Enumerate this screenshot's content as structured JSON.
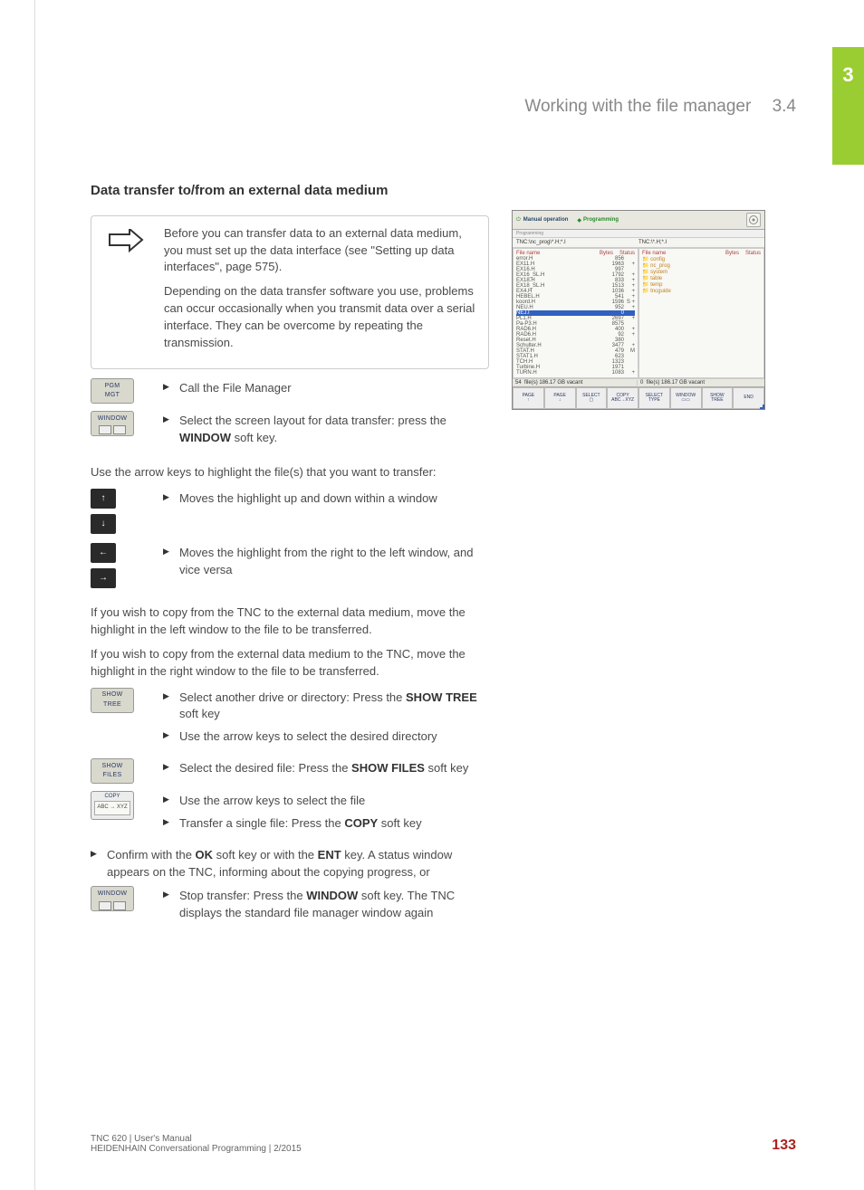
{
  "header": {
    "title": "Working with the file manager",
    "section": "3.4"
  },
  "chapter_tab": "3",
  "h2": "Data transfer to/from an external data medium",
  "note": {
    "p1": "Before you can transfer data to an external data medium, you must set up the data interface (see \"Setting up data interfaces\", page 575).",
    "p2": "Depending on the data transfer software you use, problems can occur occasionally when you transmit data over a serial interface. They can be overcome by repeating the transmission."
  },
  "keys": {
    "pgm_mgt": "PGM\nMGT",
    "window": "WINDOW",
    "show_tree": "SHOW\nTREE",
    "show_files": "SHOW\nFILES",
    "copy": "COPY",
    "copy_strip": "ABC → XYZ"
  },
  "steps": {
    "call": "Call the File Manager",
    "select_layout_a": "Select the screen layout for data transfer: press the ",
    "select_layout_b": " soft key.",
    "window_bold": "WINDOW"
  },
  "arrow_intro": "Use the arrow keys to highlight the file(s) that you want to transfer:",
  "arrows": {
    "updown": "Moves the highlight up and down within a window",
    "leftright": "Moves the highlight from the right to the left window, and vice versa"
  },
  "mid_p1": "If you wish to copy from the TNC to the external data medium, move the highlight in the left window to the file to be transferred.",
  "mid_p2": "If you wish to copy from the external data medium to the TNC, move the highlight in the right window to the file to be transferred.",
  "steps2": {
    "show_tree_a": "Select another drive or directory: Press the ",
    "show_tree_b": " soft key",
    "show_tree_bold": "SHOW TREE",
    "arrow_dir": "Use the arrow keys to select the desired directory",
    "show_files_a": "Select the desired file: Press the ",
    "show_files_b": " soft key",
    "show_files_bold": "SHOW FILES",
    "arrow_file": "Use the arrow keys to select the file",
    "copy_a": "Transfer a single file: Press the ",
    "copy_b": " soft key",
    "copy_bold": "COPY"
  },
  "confirm_a": "Confirm with the ",
  "confirm_ok": "OK",
  "confirm_b": " soft key or with the ",
  "confirm_ent": "ENT",
  "confirm_c": " key. A status window appears on the TNC, informing about the copying progress, or",
  "stop_a": "Stop transfer: Press the ",
  "stop_bold": "WINDOW",
  "stop_b": " soft key. The TNC displays the standard file manager window again",
  "screenshot": {
    "mode_left": "Manual operation",
    "mode_right": "Programming",
    "sub_right": "Programming",
    "path_left": "TNC:\\nc_prog\\*.H;*.I",
    "path_right": "TNC:\\*.H;*.I",
    "col_fn": "File name",
    "col_by": "Bytes",
    "col_st": "Status",
    "left_files": [
      {
        "n": "error.H",
        "b": "856"
      },
      {
        "n": "EX11.H",
        "b": "1963",
        "s": "+"
      },
      {
        "n": "EX16.H",
        "b": "997"
      },
      {
        "n": "EX16_SL.H",
        "b": "1792",
        "s": "+"
      },
      {
        "n": "EX18.H",
        "b": "833",
        "s": "+"
      },
      {
        "n": "EX18_SL.H",
        "b": "1513",
        "s": "+"
      },
      {
        "n": "EX4.H",
        "b": "1036",
        "s": "+"
      },
      {
        "n": "HEBEL.H",
        "b": "541",
        "s": "+"
      },
      {
        "n": "koord.H",
        "b": "1596",
        "s": "S +"
      },
      {
        "n": "NEU.H",
        "b": "952",
        "s": "+"
      },
      {
        "n": "NEJ.I",
        "b": "0",
        "s": "",
        "hl": true
      },
      {
        "n": "PL1.H",
        "b": "2697",
        "s": "+"
      },
      {
        "n": "Pa-P3.H",
        "b": "8575"
      },
      {
        "n": "RAD6.H",
        "b": "400",
        "s": "+"
      },
      {
        "n": "RAD6.H",
        "b": "92",
        "s": "+"
      },
      {
        "n": "Reset.H",
        "b": "380"
      },
      {
        "n": "Schulter.H",
        "b": "3477",
        "s": "+"
      },
      {
        "n": "STAT.H",
        "b": "479",
        "s": "M"
      },
      {
        "n": "STAT1.H",
        "b": "623"
      },
      {
        "n": "TCH.H",
        "b": "1323"
      },
      {
        "n": "Turbine.H",
        "b": "1971"
      },
      {
        "n": "TURN.H",
        "b": "1083",
        "s": "+"
      }
    ],
    "right_files": [
      {
        "n": "config",
        "folder": true
      },
      {
        "n": "nc_prog",
        "folder": true
      },
      {
        "n": "system",
        "folder": true
      },
      {
        "n": "table",
        "folder": true
      },
      {
        "n": "temp",
        "folder": true
      },
      {
        "n": "tncguide",
        "folder": true
      }
    ],
    "status_left_a": "54",
    "status_left_b": "file(s) 186.17 GB vacant",
    "status_right_a": "0",
    "status_right_b": "file(s) 186.17 GB vacant",
    "softkeys": [
      "PAGE\n↑",
      "PAGE\n↓",
      "SELECT\n▢",
      "COPY\nABC→XYZ",
      "SELECT\nTYPE",
      "WINDOW\n▭▭",
      "SHOW\nTREE",
      "END"
    ]
  },
  "footer": {
    "line1": "TNC 620 | User's Manual",
    "line2": "HEIDENHAIN Conversational Programming | 2/2015",
    "page": "133"
  }
}
